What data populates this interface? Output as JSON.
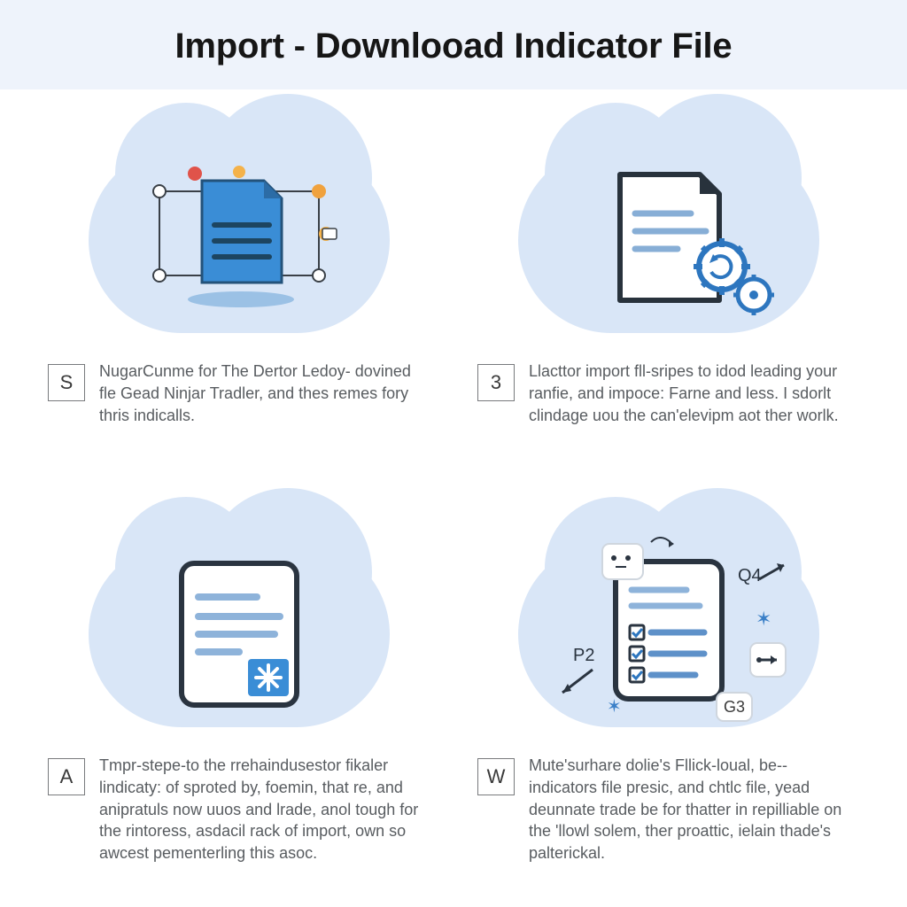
{
  "header": {
    "title": "Import - Downlooad Indicator File"
  },
  "cells": [
    {
      "badge": "S",
      "desc": "NugarCunme for The Dertor Ledoy- dovined fle Gead Ninjar Tradler, and thes remes fory thris indicalls."
    },
    {
      "badge": "3",
      "desc": "Llacttor import fll-sripes to idod leading your ranfie, and impoce: Farne and less. I sdorlt clindage uou the can'elevipm aot ther worlk."
    },
    {
      "badge": "A",
      "desc": "Tmpr-stepe-to the rrehaindusestor fikaler lindicaty: of sproted by, foemin, that re, and anipratuls now uuos and lrade, anol tough for the rintoress, asdacil rack of import, own so awcest pementerling this asoc."
    },
    {
      "badge": "W",
      "desc": "Mute'surhare dolie's Fllick-loual, be-- indicators file presic, and chtlc file, yead deunnate trade be for thatter in repilliable on the 'llowl solem, ther proattic, ielain thade's palterickal."
    }
  ],
  "annotations": {
    "q4": "Q4",
    "p2": "P2",
    "g3": "G3"
  }
}
